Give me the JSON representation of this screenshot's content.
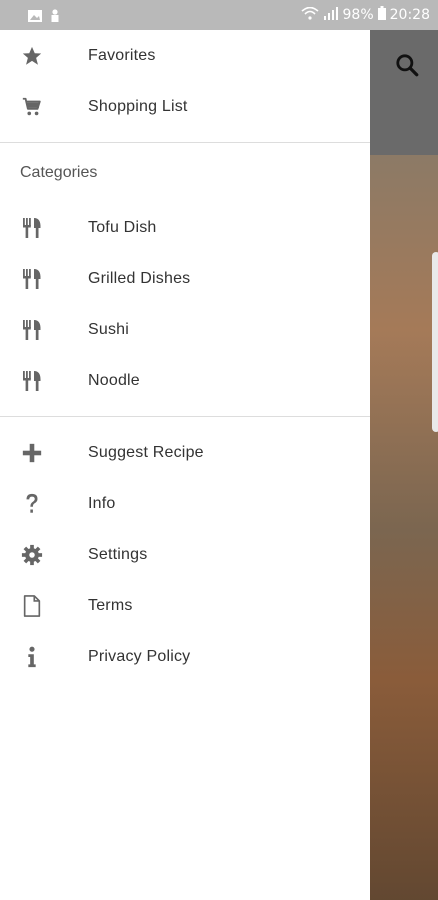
{
  "status_bar": {
    "battery": "98%",
    "time": "20:28",
    "icons": [
      "gallery-icon",
      "person-icon",
      "wifi-icon",
      "signal-icon",
      "battery-icon"
    ]
  },
  "background": {
    "search_icon": "search-icon"
  },
  "drawer": {
    "top_items": [
      {
        "label": "Favorites",
        "icon": "star-icon"
      },
      {
        "label": "Shopping List",
        "icon": "cart-icon"
      }
    ],
    "categories_header": "Categories",
    "categories": [
      {
        "label": "Tofu Dish",
        "icon": "restaurant-icon"
      },
      {
        "label": "Grilled Dishes",
        "icon": "restaurant-icon"
      },
      {
        "label": "Sushi",
        "icon": "restaurant-icon"
      },
      {
        "label": "Noodle",
        "icon": "restaurant-icon"
      }
    ],
    "bottom_items": [
      {
        "label": "Suggest Recipe",
        "icon": "plus-icon"
      },
      {
        "label": "Info",
        "icon": "question-icon"
      },
      {
        "label": "Settings",
        "icon": "gear-icon"
      },
      {
        "label": "Terms",
        "icon": "document-icon"
      },
      {
        "label": "Privacy Policy",
        "icon": "info-icon"
      }
    ]
  },
  "colors": {
    "drawer_bg": "#ffffff",
    "icon_color": "#666666",
    "text_color": "#333333",
    "status_bar_bg": "#b9b9b9"
  }
}
